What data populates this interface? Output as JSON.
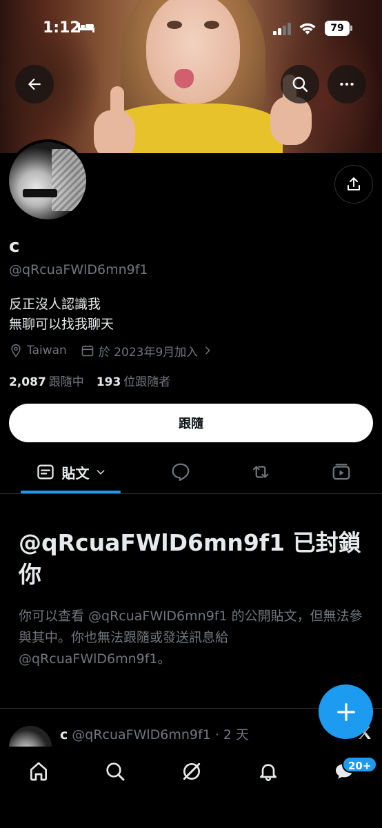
{
  "status_bar": {
    "time": "1:12",
    "battery": "79"
  },
  "profile": {
    "display_name": "c",
    "handle": "@qRcuaFWlD6mn9f1",
    "bio": "反正沒人認識我\n無聊可以找我聊天",
    "location": "Taiwan",
    "joined": "於 2023年9月加入",
    "following_count": "2,087",
    "following_label": "跟隨中",
    "followers_count": "193",
    "followers_label": "位跟隨者",
    "follow_button": "跟隨"
  },
  "tabs": {
    "posts": "貼文"
  },
  "blocked": {
    "title": "@qRcuaFWlD6mn9f1 已封鎖你",
    "message": "你可以查看 @qRcuaFWlD6mn9f1 的公開貼文，但無法參與其中。你也無法跟隨或發送訊息給 @qRcuaFWlD6mn9f1。"
  },
  "post_preview": {
    "name": "c",
    "handle_time": "@qRcuaFWlD6mn9f1 · 2 天"
  },
  "nav": {
    "messages_badge": "20+"
  },
  "colors": {
    "accent": "#1d9bf0",
    "background": "#000000",
    "secondary_text": "#71767b",
    "primary_text": "#e7e9ea"
  }
}
